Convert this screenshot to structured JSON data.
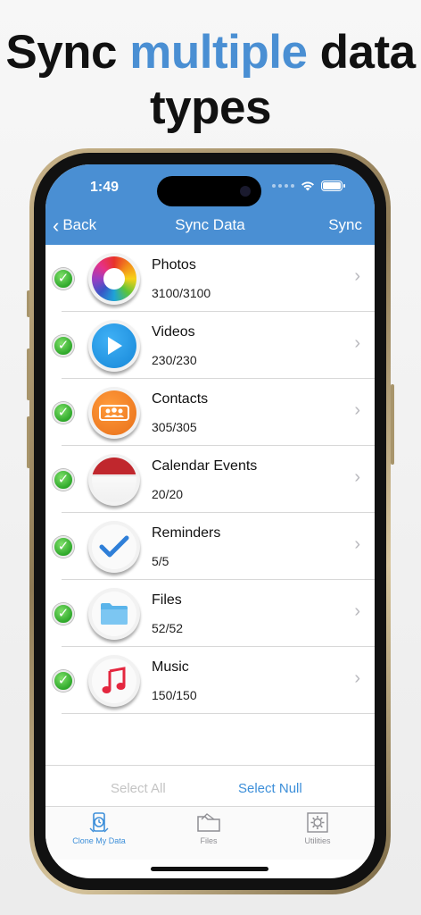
{
  "headline": {
    "part1": "Sync ",
    "accent": "multiple",
    "part2": " data",
    "line2": "types"
  },
  "status": {
    "time": "1:49"
  },
  "nav": {
    "back": "Back",
    "title": "Sync Data",
    "action": "Sync"
  },
  "items": [
    {
      "title": "Photos",
      "count": "3100/3100",
      "icon": "photos-icon"
    },
    {
      "title": "Videos",
      "count": "230/230",
      "icon": "videos-icon"
    },
    {
      "title": "Contacts",
      "count": "305/305",
      "icon": "contacts-icon"
    },
    {
      "title": "Calendar Events",
      "count": "20/20",
      "icon": "calendar-icon"
    },
    {
      "title": "Reminders",
      "count": "5/5",
      "icon": "reminders-icon"
    },
    {
      "title": "Files",
      "count": "52/52",
      "icon": "files-icon"
    },
    {
      "title": "Music",
      "count": "150/150",
      "icon": "music-icon"
    }
  ],
  "bottom": {
    "select_all": "Select All",
    "select_null": "Select Null"
  },
  "tabs": [
    {
      "label": "Clone My Data",
      "icon": "clone-icon",
      "active": true
    },
    {
      "label": "Files",
      "icon": "folder-icon",
      "active": false
    },
    {
      "label": "Utilities",
      "icon": "gear-icon",
      "active": false
    }
  ],
  "colors": {
    "accent": "#4a8fd3",
    "link": "#3d8fd9",
    "check": "#2ea82a",
    "frame": "#b8a478"
  }
}
